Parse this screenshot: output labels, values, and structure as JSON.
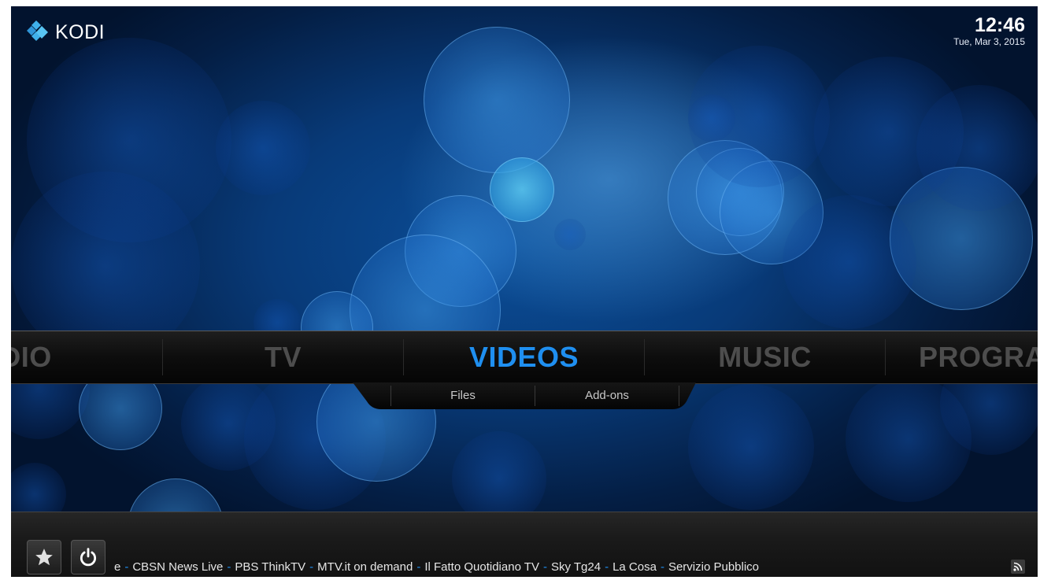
{
  "app": {
    "logo_text": "KODI"
  },
  "header": {
    "time": "12:46",
    "date": "Tue, Mar 3, 2015"
  },
  "main_menu": {
    "items": [
      {
        "label": "RADIO",
        "selected": false
      },
      {
        "label": "TV",
        "selected": false
      },
      {
        "label": "VIDEOS",
        "selected": true
      },
      {
        "label": "MUSIC",
        "selected": false
      },
      {
        "label": "PROGRAMS",
        "selected": false
      }
    ]
  },
  "submenu": {
    "items": [
      {
        "label": "Files"
      },
      {
        "label": "Add-ons"
      }
    ]
  },
  "footer": {
    "buttons": [
      {
        "icon": "star-icon"
      },
      {
        "icon": "power-icon"
      }
    ],
    "rss_lead": "e",
    "rss_items": [
      "CBSN News Live",
      "PBS ThinkTV",
      "MTV.it on demand",
      "Il Fatto Quotidiano TV",
      "Sky Tg24",
      "La Cosa",
      "Servizio Pubblico"
    ],
    "rss_separator": "-",
    "rss_icon": "rss-icon"
  },
  "colors": {
    "accent": "#1f8ff0",
    "inactive_menu": "#4d4d4d",
    "background": "#083a78"
  }
}
